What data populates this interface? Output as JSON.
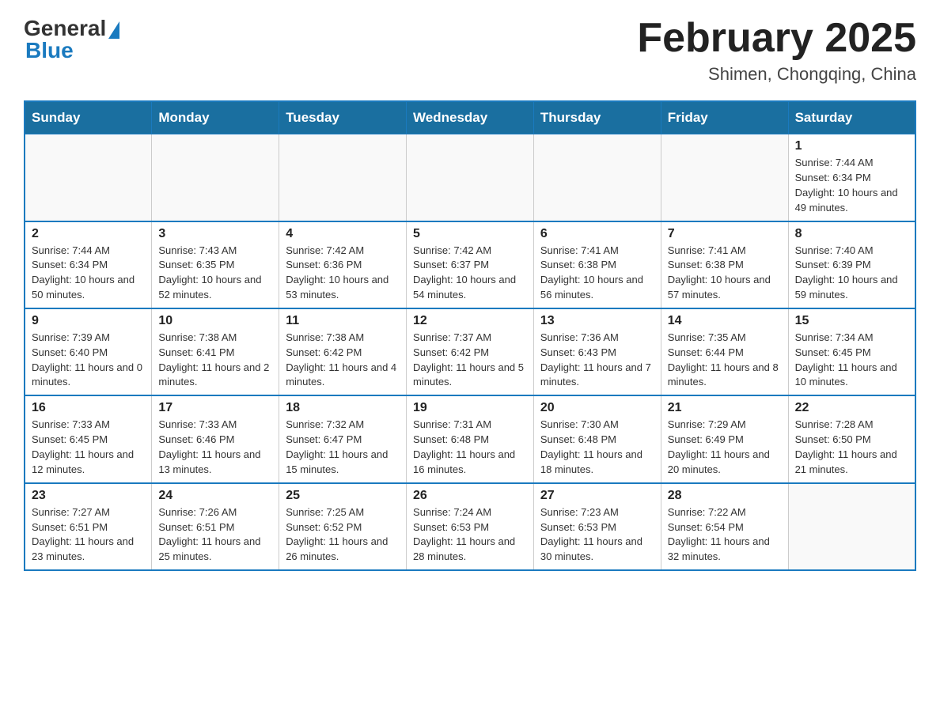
{
  "header": {
    "logo": {
      "general": "General",
      "blue": "Blue"
    },
    "title": "February 2025",
    "location": "Shimen, Chongqing, China"
  },
  "days_of_week": [
    "Sunday",
    "Monday",
    "Tuesday",
    "Wednesday",
    "Thursday",
    "Friday",
    "Saturday"
  ],
  "weeks": [
    [
      {
        "day": "",
        "sunrise": "",
        "sunset": "",
        "daylight": ""
      },
      {
        "day": "",
        "sunrise": "",
        "sunset": "",
        "daylight": ""
      },
      {
        "day": "",
        "sunrise": "",
        "sunset": "",
        "daylight": ""
      },
      {
        "day": "",
        "sunrise": "",
        "sunset": "",
        "daylight": ""
      },
      {
        "day": "",
        "sunrise": "",
        "sunset": "",
        "daylight": ""
      },
      {
        "day": "",
        "sunrise": "",
        "sunset": "",
        "daylight": ""
      },
      {
        "day": "1",
        "sunrise": "Sunrise: 7:44 AM",
        "sunset": "Sunset: 6:34 PM",
        "daylight": "Daylight: 10 hours and 49 minutes."
      }
    ],
    [
      {
        "day": "2",
        "sunrise": "Sunrise: 7:44 AM",
        "sunset": "Sunset: 6:34 PM",
        "daylight": "Daylight: 10 hours and 50 minutes."
      },
      {
        "day": "3",
        "sunrise": "Sunrise: 7:43 AM",
        "sunset": "Sunset: 6:35 PM",
        "daylight": "Daylight: 10 hours and 52 minutes."
      },
      {
        "day": "4",
        "sunrise": "Sunrise: 7:42 AM",
        "sunset": "Sunset: 6:36 PM",
        "daylight": "Daylight: 10 hours and 53 minutes."
      },
      {
        "day": "5",
        "sunrise": "Sunrise: 7:42 AM",
        "sunset": "Sunset: 6:37 PM",
        "daylight": "Daylight: 10 hours and 54 minutes."
      },
      {
        "day": "6",
        "sunrise": "Sunrise: 7:41 AM",
        "sunset": "Sunset: 6:38 PM",
        "daylight": "Daylight: 10 hours and 56 minutes."
      },
      {
        "day": "7",
        "sunrise": "Sunrise: 7:41 AM",
        "sunset": "Sunset: 6:38 PM",
        "daylight": "Daylight: 10 hours and 57 minutes."
      },
      {
        "day": "8",
        "sunrise": "Sunrise: 7:40 AM",
        "sunset": "Sunset: 6:39 PM",
        "daylight": "Daylight: 10 hours and 59 minutes."
      }
    ],
    [
      {
        "day": "9",
        "sunrise": "Sunrise: 7:39 AM",
        "sunset": "Sunset: 6:40 PM",
        "daylight": "Daylight: 11 hours and 0 minutes."
      },
      {
        "day": "10",
        "sunrise": "Sunrise: 7:38 AM",
        "sunset": "Sunset: 6:41 PM",
        "daylight": "Daylight: 11 hours and 2 minutes."
      },
      {
        "day": "11",
        "sunrise": "Sunrise: 7:38 AM",
        "sunset": "Sunset: 6:42 PM",
        "daylight": "Daylight: 11 hours and 4 minutes."
      },
      {
        "day": "12",
        "sunrise": "Sunrise: 7:37 AM",
        "sunset": "Sunset: 6:42 PM",
        "daylight": "Daylight: 11 hours and 5 minutes."
      },
      {
        "day": "13",
        "sunrise": "Sunrise: 7:36 AM",
        "sunset": "Sunset: 6:43 PM",
        "daylight": "Daylight: 11 hours and 7 minutes."
      },
      {
        "day": "14",
        "sunrise": "Sunrise: 7:35 AM",
        "sunset": "Sunset: 6:44 PM",
        "daylight": "Daylight: 11 hours and 8 minutes."
      },
      {
        "day": "15",
        "sunrise": "Sunrise: 7:34 AM",
        "sunset": "Sunset: 6:45 PM",
        "daylight": "Daylight: 11 hours and 10 minutes."
      }
    ],
    [
      {
        "day": "16",
        "sunrise": "Sunrise: 7:33 AM",
        "sunset": "Sunset: 6:45 PM",
        "daylight": "Daylight: 11 hours and 12 minutes."
      },
      {
        "day": "17",
        "sunrise": "Sunrise: 7:33 AM",
        "sunset": "Sunset: 6:46 PM",
        "daylight": "Daylight: 11 hours and 13 minutes."
      },
      {
        "day": "18",
        "sunrise": "Sunrise: 7:32 AM",
        "sunset": "Sunset: 6:47 PM",
        "daylight": "Daylight: 11 hours and 15 minutes."
      },
      {
        "day": "19",
        "sunrise": "Sunrise: 7:31 AM",
        "sunset": "Sunset: 6:48 PM",
        "daylight": "Daylight: 11 hours and 16 minutes."
      },
      {
        "day": "20",
        "sunrise": "Sunrise: 7:30 AM",
        "sunset": "Sunset: 6:48 PM",
        "daylight": "Daylight: 11 hours and 18 minutes."
      },
      {
        "day": "21",
        "sunrise": "Sunrise: 7:29 AM",
        "sunset": "Sunset: 6:49 PM",
        "daylight": "Daylight: 11 hours and 20 minutes."
      },
      {
        "day": "22",
        "sunrise": "Sunrise: 7:28 AM",
        "sunset": "Sunset: 6:50 PM",
        "daylight": "Daylight: 11 hours and 21 minutes."
      }
    ],
    [
      {
        "day": "23",
        "sunrise": "Sunrise: 7:27 AM",
        "sunset": "Sunset: 6:51 PM",
        "daylight": "Daylight: 11 hours and 23 minutes."
      },
      {
        "day": "24",
        "sunrise": "Sunrise: 7:26 AM",
        "sunset": "Sunset: 6:51 PM",
        "daylight": "Daylight: 11 hours and 25 minutes."
      },
      {
        "day": "25",
        "sunrise": "Sunrise: 7:25 AM",
        "sunset": "Sunset: 6:52 PM",
        "daylight": "Daylight: 11 hours and 26 minutes."
      },
      {
        "day": "26",
        "sunrise": "Sunrise: 7:24 AM",
        "sunset": "Sunset: 6:53 PM",
        "daylight": "Daylight: 11 hours and 28 minutes."
      },
      {
        "day": "27",
        "sunrise": "Sunrise: 7:23 AM",
        "sunset": "Sunset: 6:53 PM",
        "daylight": "Daylight: 11 hours and 30 minutes."
      },
      {
        "day": "28",
        "sunrise": "Sunrise: 7:22 AM",
        "sunset": "Sunset: 6:54 PM",
        "daylight": "Daylight: 11 hours and 32 minutes."
      },
      {
        "day": "",
        "sunrise": "",
        "sunset": "",
        "daylight": ""
      }
    ]
  ]
}
